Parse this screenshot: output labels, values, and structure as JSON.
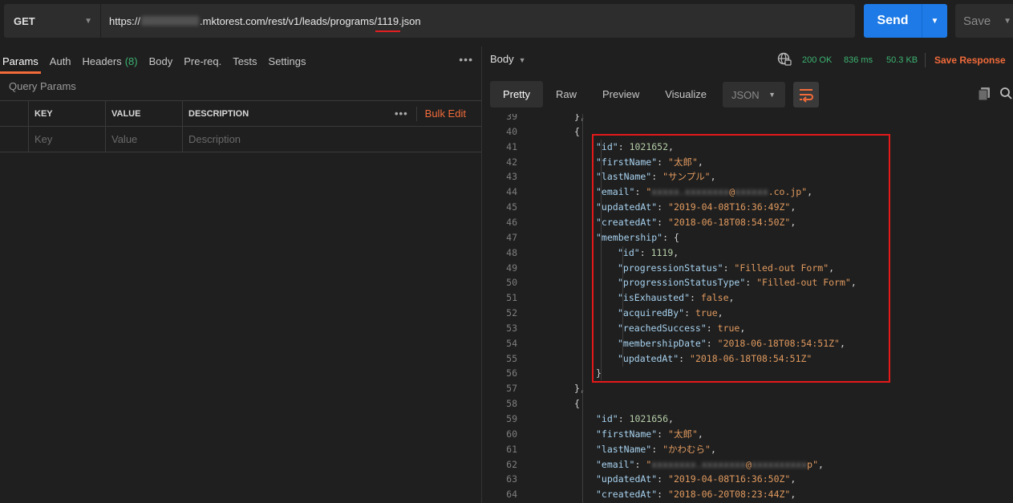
{
  "request": {
    "method": "GET",
    "url_prefix": "https://",
    "url_host": ".mktorest.com/rest/v1/leads/programs/",
    "url_highlight": "1119",
    "url_suffix": ".json",
    "send_label": "Send",
    "save_label": "Save"
  },
  "left": {
    "tabs": [
      {
        "label": "Params"
      },
      {
        "label": "Auth"
      },
      {
        "label": "Headers",
        "count": "(8)"
      },
      {
        "label": "Body"
      },
      {
        "label": "Pre-req."
      },
      {
        "label": "Tests"
      },
      {
        "label": "Settings"
      }
    ],
    "more": "•••",
    "query_params_title": "Query Params",
    "table": {
      "headers": {
        "key": "KEY",
        "value": "VALUE",
        "description": "DESCRIPTION",
        "bulk_edit": "Bulk Edit",
        "more": "•••"
      },
      "placeholders": {
        "key": "Key",
        "value": "Value",
        "description": "Description"
      }
    }
  },
  "response": {
    "body_label": "Body",
    "status": "200 OK",
    "time": "836 ms",
    "size": "50.3 KB",
    "save_response": "Save Response",
    "view_tabs": [
      "Pretty",
      "Raw",
      "Preview",
      "Visualize"
    ],
    "format": "JSON",
    "lines": [
      {
        "n": "39",
        "indent": 3,
        "parts": [
          [
            "p",
            "},"
          ]
        ]
      },
      {
        "n": "40",
        "indent": 3,
        "parts": [
          [
            "p",
            "{"
          ]
        ]
      },
      {
        "n": "41",
        "indent": 4,
        "parts": [
          [
            "k",
            "\"id\""
          ],
          [
            "p",
            ": "
          ],
          [
            "n",
            "1021652"
          ],
          [
            "p",
            ","
          ]
        ]
      },
      {
        "n": "42",
        "indent": 4,
        "parts": [
          [
            "k",
            "\"firstName\""
          ],
          [
            "p",
            ": "
          ],
          [
            "s",
            "\"太郎\""
          ],
          [
            "p",
            ","
          ]
        ]
      },
      {
        "n": "43",
        "indent": 4,
        "parts": [
          [
            "k",
            "\"lastName\""
          ],
          [
            "p",
            ": "
          ],
          [
            "s",
            "\"サンプル\""
          ],
          [
            "p",
            ","
          ]
        ]
      },
      {
        "n": "44",
        "indent": 4,
        "parts": [
          [
            "k",
            "\"email\""
          ],
          [
            "p",
            ": "
          ],
          [
            "s",
            "\""
          ],
          [
            "x",
            "xxxxx.xxxxxxxx"
          ],
          [
            "s",
            "@"
          ],
          [
            "x",
            "xxxxxx"
          ],
          [
            "s",
            ".co.jp\""
          ],
          [
            "p",
            ","
          ]
        ]
      },
      {
        "n": "45",
        "indent": 4,
        "parts": [
          [
            "k",
            "\"updatedAt\""
          ],
          [
            "p",
            ": "
          ],
          [
            "s",
            "\"2019-04-08T16:36:49Z\""
          ],
          [
            "p",
            ","
          ]
        ]
      },
      {
        "n": "46",
        "indent": 4,
        "parts": [
          [
            "k",
            "\"createdAt\""
          ],
          [
            "p",
            ": "
          ],
          [
            "s",
            "\"2018-06-18T08:54:50Z\""
          ],
          [
            "p",
            ","
          ]
        ]
      },
      {
        "n": "47",
        "indent": 4,
        "parts": [
          [
            "k",
            "\"membership\""
          ],
          [
            "p",
            ": {"
          ]
        ]
      },
      {
        "n": "48",
        "indent": 5,
        "parts": [
          [
            "k",
            "\"id\""
          ],
          [
            "p",
            ": "
          ],
          [
            "n",
            "1119"
          ],
          [
            "p",
            ","
          ]
        ]
      },
      {
        "n": "49",
        "indent": 5,
        "parts": [
          [
            "k",
            "\"progressionStatus\""
          ],
          [
            "p",
            ": "
          ],
          [
            "s",
            "\"Filled-out Form\""
          ],
          [
            "p",
            ","
          ]
        ]
      },
      {
        "n": "50",
        "indent": 5,
        "parts": [
          [
            "k",
            "\"progressionStatusType\""
          ],
          [
            "p",
            ": "
          ],
          [
            "s",
            "\"Filled-out Form\""
          ],
          [
            "p",
            ","
          ]
        ]
      },
      {
        "n": "51",
        "indent": 5,
        "parts": [
          [
            "k",
            "\"isExhausted\""
          ],
          [
            "p",
            ": "
          ],
          [
            "b",
            "false"
          ],
          [
            "p",
            ","
          ]
        ]
      },
      {
        "n": "52",
        "indent": 5,
        "parts": [
          [
            "k",
            "\"acquiredBy\""
          ],
          [
            "p",
            ": "
          ],
          [
            "b",
            "true"
          ],
          [
            "p",
            ","
          ]
        ]
      },
      {
        "n": "53",
        "indent": 5,
        "parts": [
          [
            "k",
            "\"reachedSuccess\""
          ],
          [
            "p",
            ": "
          ],
          [
            "b",
            "true"
          ],
          [
            "p",
            ","
          ]
        ]
      },
      {
        "n": "54",
        "indent": 5,
        "parts": [
          [
            "k",
            "\"membershipDate\""
          ],
          [
            "p",
            ": "
          ],
          [
            "s",
            "\"2018-06-18T08:54:51Z\""
          ],
          [
            "p",
            ","
          ]
        ]
      },
      {
        "n": "55",
        "indent": 5,
        "parts": [
          [
            "k",
            "\"updatedAt\""
          ],
          [
            "p",
            ": "
          ],
          [
            "s",
            "\"2018-06-18T08:54:51Z\""
          ]
        ]
      },
      {
        "n": "56",
        "indent": 4,
        "parts": [
          [
            "p",
            "}"
          ]
        ]
      },
      {
        "n": "57",
        "indent": 3,
        "parts": [
          [
            "p",
            "},"
          ]
        ]
      },
      {
        "n": "58",
        "indent": 3,
        "parts": [
          [
            "p",
            "{"
          ]
        ]
      },
      {
        "n": "59",
        "indent": 4,
        "parts": [
          [
            "k",
            "\"id\""
          ],
          [
            "p",
            ": "
          ],
          [
            "n",
            "1021656"
          ],
          [
            "p",
            ","
          ]
        ]
      },
      {
        "n": "60",
        "indent": 4,
        "parts": [
          [
            "k",
            "\"firstName\""
          ],
          [
            "p",
            ": "
          ],
          [
            "s",
            "\"太郎\""
          ],
          [
            "p",
            ","
          ]
        ]
      },
      {
        "n": "61",
        "indent": 4,
        "parts": [
          [
            "k",
            "\"lastName\""
          ],
          [
            "p",
            ": "
          ],
          [
            "s",
            "\"かわむら\""
          ],
          [
            "p",
            ","
          ]
        ]
      },
      {
        "n": "62",
        "indent": 4,
        "parts": [
          [
            "k",
            "\"email\""
          ],
          [
            "p",
            ": "
          ],
          [
            "s",
            "\""
          ],
          [
            "x",
            "xxxxxxxx.xxxxxxxx"
          ],
          [
            "s",
            "@"
          ],
          [
            "x",
            "xxxxxxxxxx"
          ],
          [
            "s",
            "p\""
          ],
          [
            "p",
            ","
          ]
        ]
      },
      {
        "n": "63",
        "indent": 4,
        "parts": [
          [
            "k",
            "\"updatedAt\""
          ],
          [
            "p",
            ": "
          ],
          [
            "s",
            "\"2019-04-08T16:36:50Z\""
          ],
          [
            "p",
            ","
          ]
        ]
      },
      {
        "n": "64",
        "indent": 4,
        "parts": [
          [
            "k",
            "\"createdAt\""
          ],
          [
            "p",
            ": "
          ],
          [
            "s",
            "\"2018-06-20T08:23:44Z\""
          ],
          [
            "p",
            ","
          ]
        ]
      }
    ]
  },
  "colors": {
    "accent": "#f26b3a",
    "send": "#1e7ae6",
    "status_ok": "#3cb371",
    "highlight_box": "#e41919"
  },
  "icons": {
    "method_dropdown": "chevron-down-icon",
    "send_dropdown": "caret-down-icon",
    "network": "globe-icon",
    "wrap": "wrap-lines-icon",
    "copy": "copy-icon",
    "search": "search-icon"
  }
}
